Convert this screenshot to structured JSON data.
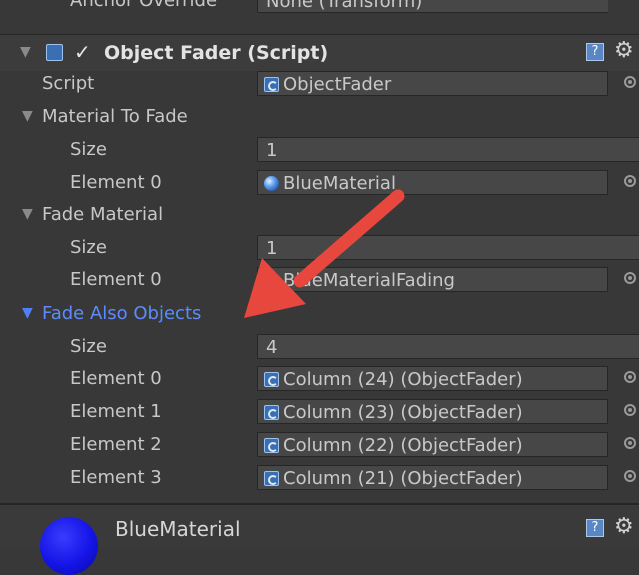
{
  "top_row": {
    "label": "Anchor Override",
    "value": "None (Transform)"
  },
  "component": {
    "title": "Object Fader (Script)",
    "script_label": "Script",
    "script_value": "ObjectFader"
  },
  "material_to_fade": {
    "label": "Material To Fade",
    "size_label": "Size",
    "size_value": "1",
    "element0_label": "Element 0",
    "element0_value": "BlueMaterial"
  },
  "fade_material": {
    "label": "Fade Material",
    "size_label": "Size",
    "size_value": "1",
    "element0_label": "Element 0",
    "element0_value": "BlueMaterialFading"
  },
  "fade_also_objects": {
    "label": "Fade Also Objects",
    "size_label": "Size",
    "size_value": "4",
    "elements": [
      {
        "label": "Element 0",
        "value": "Column (24) (ObjectFader)"
      },
      {
        "label": "Element 1",
        "value": "Column (23) (ObjectFader)"
      },
      {
        "label": "Element 2",
        "value": "Column (22) (ObjectFader)"
      },
      {
        "label": "Element 3",
        "value": "Column (21) (ObjectFader)"
      }
    ]
  },
  "bottom": {
    "title": "BlueMaterial"
  },
  "colors": {
    "background": "#383838",
    "highlight_blue": "#4d7fff",
    "arrow_red": "#e8473d"
  }
}
